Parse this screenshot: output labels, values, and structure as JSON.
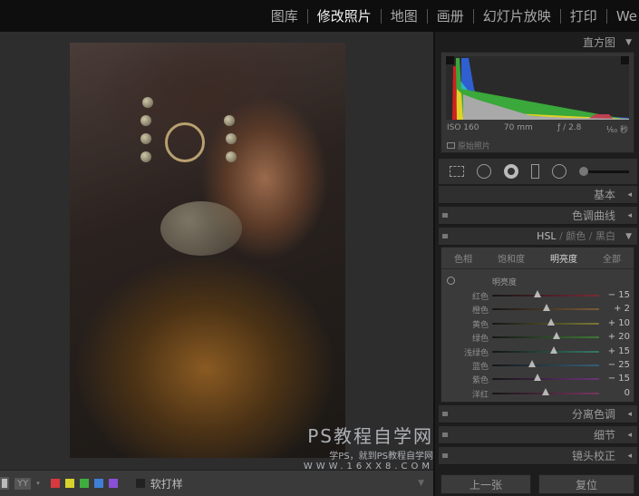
{
  "top_nav": {
    "modules": [
      "图库",
      "修改照片",
      "地图",
      "画册",
      "幻灯片放映",
      "打印",
      "We"
    ],
    "active": "修改照片"
  },
  "watermark": {
    "title": "PS教程自学网",
    "subtitle": "学PS，就到PS教程自学网",
    "url": "WWW.16XX8.COM"
  },
  "bottom_toolbar": {
    "view_label": "YY",
    "color_labels": [
      "#d8393f",
      "#d7d32c",
      "#3fae3f",
      "#3f7fd8",
      "#8a4fd8"
    ],
    "soft_proof": "软打样"
  },
  "histogram": {
    "title": "直方图",
    "iso": "ISO 160",
    "focal": "70 mm",
    "aperture": "ƒ / 2.8",
    "shutter": "¹⁄₆₀ 秒",
    "original_photo": "原始照片"
  },
  "panels": {
    "basic": "基本",
    "tone_curve": "色调曲线",
    "split_toning": "分离色调",
    "detail": "细节",
    "lens": "镜头校正"
  },
  "hsl": {
    "header": [
      "HSL",
      "/",
      "颜色",
      "/",
      "黑白"
    ],
    "tabs": [
      "色相",
      "饱和度",
      "明亮度",
      "全部"
    ],
    "active_tab": "明亮度",
    "section": "明亮度",
    "sliders": [
      {
        "label": "红色",
        "value": -15,
        "display": "− 15",
        "color": "#7a2a35"
      },
      {
        "label": "橙色",
        "value": 2,
        "display": "+ 2",
        "color": "#7a5a35"
      },
      {
        "label": "黄色",
        "value": 10,
        "display": "+ 10",
        "color": "#7a7a35"
      },
      {
        "label": "绿色",
        "value": 20,
        "display": "+ 20",
        "color": "#3f7a35"
      },
      {
        "label": "浅绿色",
        "value": 15,
        "display": "+ 15",
        "color": "#357a6a"
      },
      {
        "label": "蓝色",
        "value": -25,
        "display": "− 25",
        "color": "#35607a"
      },
      {
        "label": "紫色",
        "value": -15,
        "display": "− 15",
        "color": "#6a357a"
      },
      {
        "label": "洋红",
        "value": 0,
        "display": "0",
        "color": "#7a3560"
      }
    ]
  },
  "buttons": {
    "previous": "上一张",
    "reset": "复位"
  }
}
